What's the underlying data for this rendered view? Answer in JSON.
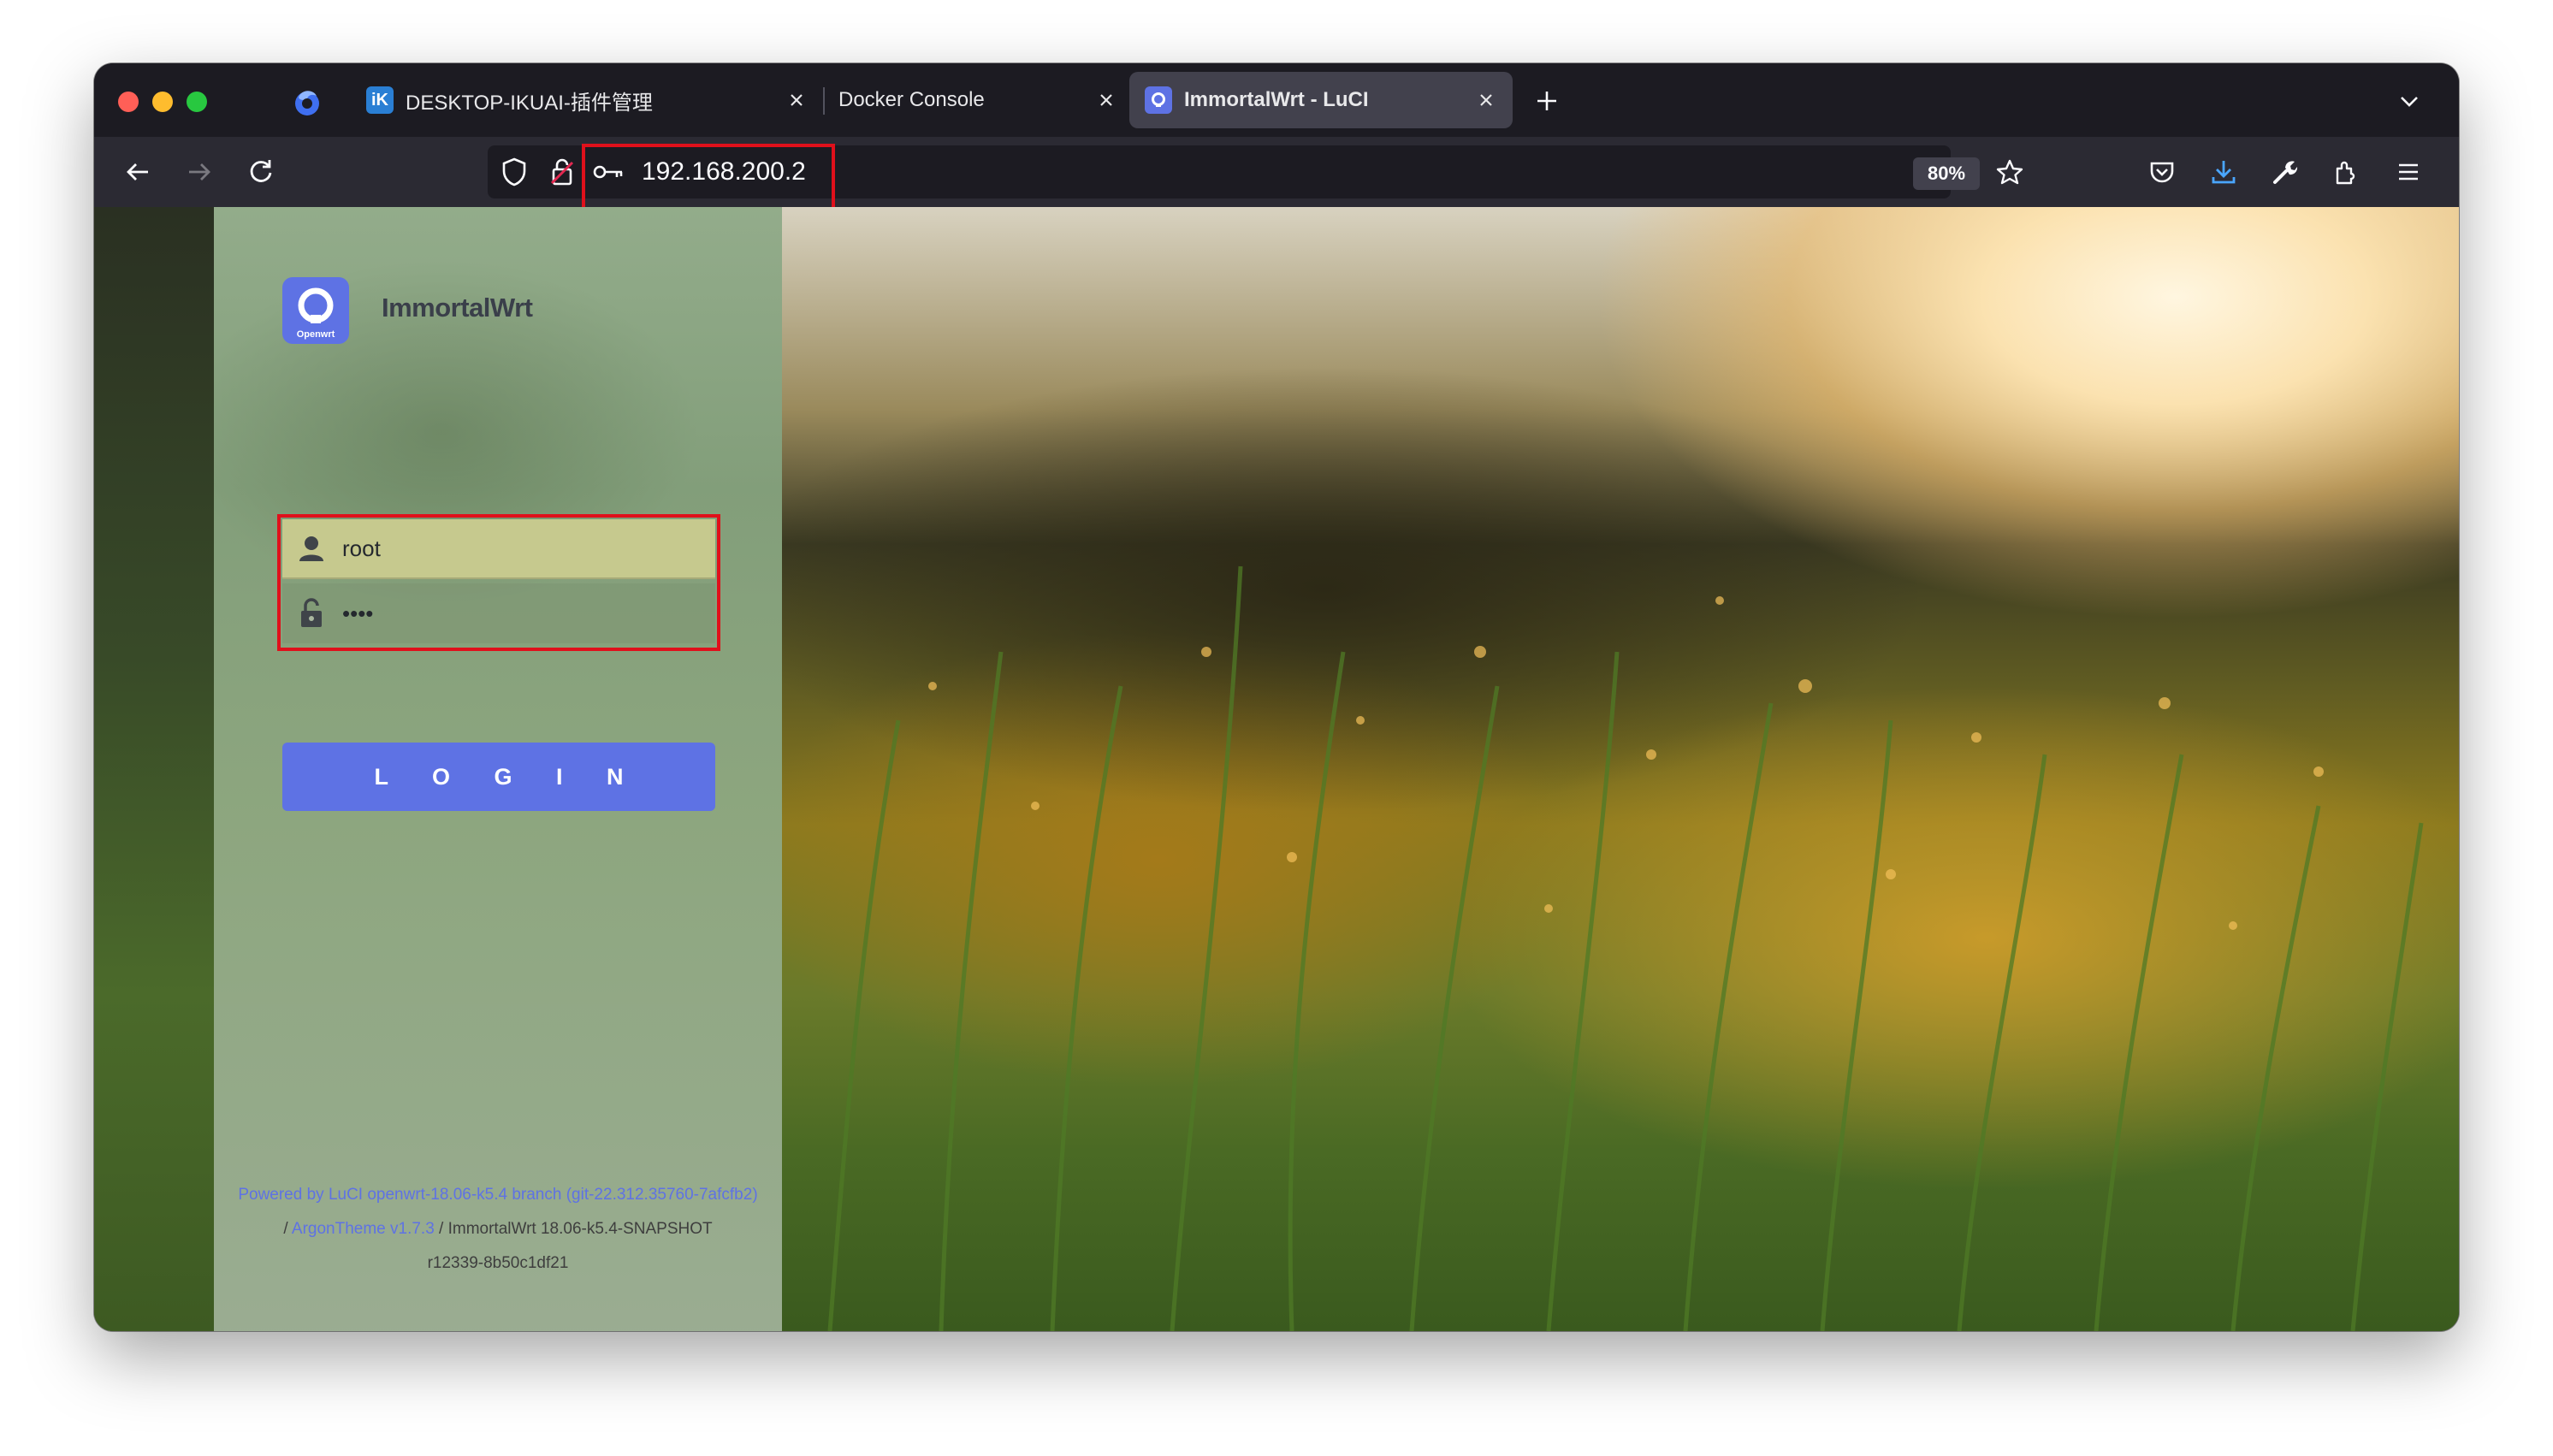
{
  "browser": {
    "tabs": [
      {
        "title": "DESKTOP-IKUAI-插件管理",
        "favicon": "ikuai-icon",
        "active": false
      },
      {
        "title": "Docker Console",
        "favicon": "",
        "active": false
      },
      {
        "title": "ImmortalWrt - LuCI",
        "favicon": "openwrt-icon",
        "active": true
      }
    ],
    "address": "192.168.200.2",
    "zoom": "80%",
    "accent_color": "#e0101b"
  },
  "login": {
    "brand": "ImmortalWrt",
    "logo_caption": "Openwrt",
    "username_value": "root",
    "password_value": "••••",
    "button_label": "L O G I N",
    "accent_color": "#5e72e4",
    "footer": {
      "powered_by": "Powered by LuCI openwrt-18.06-k5.4 branch (git-22.312.35760-7afcfb2)",
      "theme_prefix": "/ ",
      "theme_link": "ArgonTheme v1.7.3",
      "firmware": " / ImmortalWrt 18.06-k5.4-SNAPSHOT",
      "revision": "r12339-8b50c1df21"
    }
  }
}
